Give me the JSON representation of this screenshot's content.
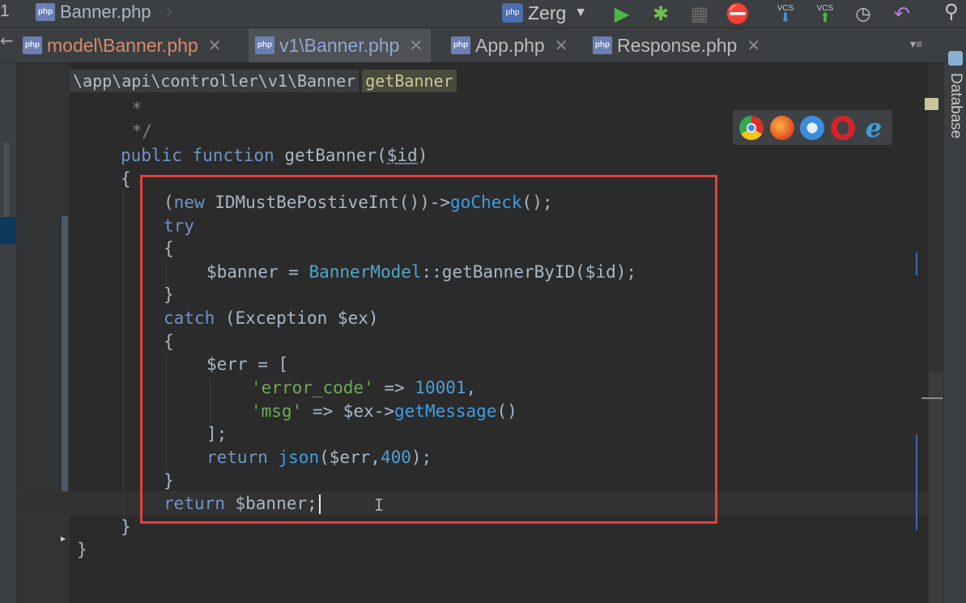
{
  "toolbar": {
    "left_number": "1",
    "file_breadcrumb": "Banner.php",
    "run_config": "Zerg",
    "vcs_label": "VCS"
  },
  "tabs": [
    {
      "label": "model\\Banner.php"
    },
    {
      "label": "v1\\Banner.php"
    },
    {
      "label": "App.php"
    },
    {
      "label": "Response.php"
    }
  ],
  "breadcrumb": {
    "path": "\\app\\api\\controller\\v1\\Banner",
    "method": "getBanner"
  },
  "sidebar": {
    "database_label": "Database"
  },
  "browsers": [
    "chrome-icon",
    "firefox-icon",
    "safari-icon",
    "opera-icon",
    "ie-icon"
  ],
  "colors": {
    "highlight_box": "#e04040",
    "keyword": "#6f94c7",
    "string": "#6ea85a",
    "number": "#4d9fd6"
  },
  "code": {
    "l1": " *",
    "l2": " */",
    "l3_kw1": "public",
    "l3_kw2": "function",
    "l3_name": "getBanner(",
    "l3_param": "$id",
    "l3_end": ")",
    "l4": "{",
    "l5_a": "(",
    "l5_new": "new",
    "l5_b": " IDMustBePostiveInt())->",
    "l5_fn": "goCheck",
    "l5_c": "();",
    "l6": "try",
    "l7": "{",
    "l8_a": "$banner = ",
    "l8_cls": "BannerModel",
    "l8_b": "::getBannerByID($id);",
    "l9": "}",
    "l10_kw": "catch",
    "l10_b": " (Exception $ex)",
    "l11": "{",
    "l12": "$err = [",
    "l13_str": "'error_code'",
    "l13_b": " => ",
    "l13_num": "10001",
    "l13_c": ",",
    "l14_str": "'msg'",
    "l14_b": " => $ex->",
    "l14_fn": "getMessage",
    "l14_c": "()",
    "l15": "];",
    "l16_kw": "return",
    "l16_fn": "json",
    "l16_b": "($err,",
    "l16_num": "400",
    "l16_c": ");",
    "l17": "}",
    "l18_kw": "return",
    "l18_b": " $banner;",
    "l19": "}",
    "l20": "}"
  }
}
